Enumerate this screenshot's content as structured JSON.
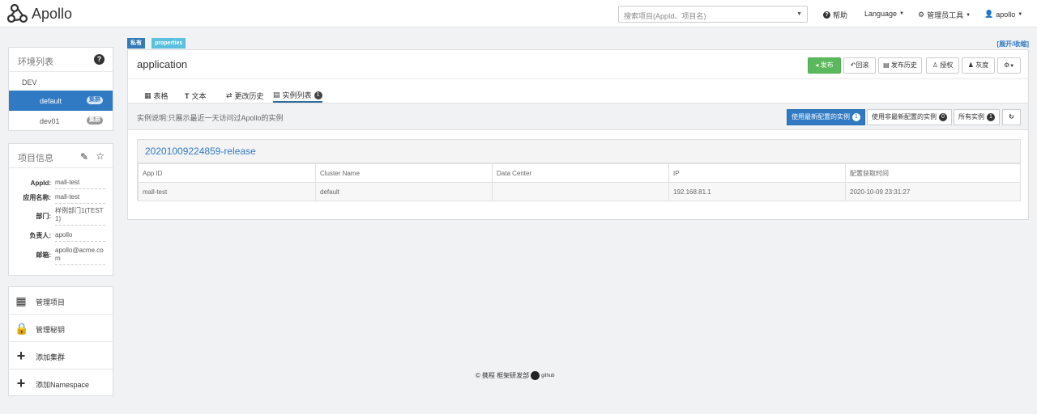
{
  "navbar": {
    "logo_text": "Apollo",
    "search_placeholder": "搜索项目(AppId、项目名)",
    "help": "帮助",
    "language": "Language",
    "admin_tools": "管理员工具",
    "user": "apollo"
  },
  "env_panel": {
    "title": "环境列表",
    "env": "DEV",
    "clusters": [
      {
        "name": "default",
        "badge": "集群",
        "active": true
      },
      {
        "name": "dev01",
        "badge": "集群",
        "active": false
      }
    ]
  },
  "info_panel": {
    "title": "项目信息",
    "fields": [
      {
        "label": "AppId:",
        "value": "mall-test"
      },
      {
        "label": "应用名称:",
        "value": "mall-test"
      },
      {
        "label": "部门:",
        "value": "样例部门1(TEST1)"
      },
      {
        "label": "负责人:",
        "value": "apollo"
      },
      {
        "label": "邮箱:",
        "value": "apollo@acme.com"
      }
    ]
  },
  "menu": [
    {
      "label": "管理项目",
      "icon": "grid-icon"
    },
    {
      "label": "管理秘钥",
      "icon": "lock-icon"
    },
    {
      "label": "添加集群",
      "icon": "plus-icon"
    },
    {
      "label": "添加Namespace",
      "icon": "plus-icon"
    }
  ],
  "namespace": {
    "tag_private": "私有",
    "tag_format": "properties",
    "expand_toggle": "[展开/收缩]",
    "name": "application",
    "buttons": {
      "publish": "发布",
      "rollback": "回滚",
      "history": "发布历史",
      "auth": "授权",
      "gray": "灰度"
    },
    "tabs": [
      {
        "label": "表格",
        "icon": "table-icon"
      },
      {
        "label": "文本",
        "icon": "text-icon"
      },
      {
        "label": "更改历史",
        "icon": "history-icon"
      },
      {
        "label": "实例列表",
        "icon": "list-icon",
        "badge": "1",
        "active": true
      }
    ],
    "instances": {
      "description": "实例说明:只展示最近一天访问过Apollo的实例",
      "filters": [
        {
          "label": "使用最新配置的实例",
          "count": "1",
          "active": true
        },
        {
          "label": "使用非最新配置的实例",
          "count": "0",
          "active": false
        },
        {
          "label": "所有实例",
          "count": "1",
          "active": false
        }
      ],
      "release_name": "20201009224859-release",
      "columns": [
        "App ID",
        "Cluster Name",
        "Data Center",
        "IP",
        "配置获取时间"
      ],
      "rows": [
        [
          "mall-test",
          "default",
          "",
          "192.168.81.1",
          "2020-10-09 23:31:27"
        ]
      ]
    }
  },
  "footer": {
    "text": "携程 框架研发部",
    "github": "github"
  },
  "colors": {
    "primary": "#2f7ac2",
    "success": "#5cb85c",
    "tag_private": "#337ab7",
    "tag_format": "#5bc0de"
  }
}
